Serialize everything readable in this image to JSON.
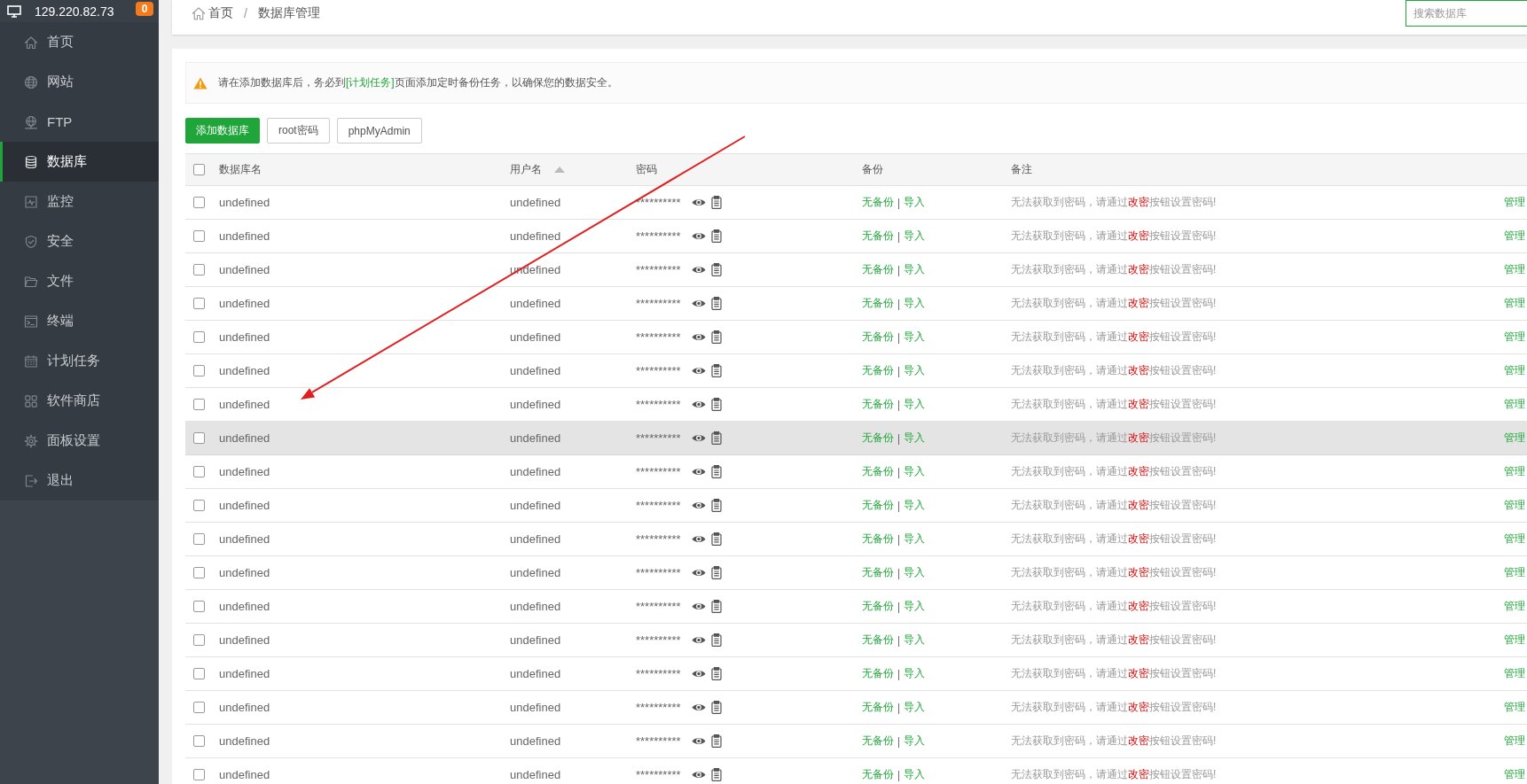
{
  "sidebar": {
    "ip": "129.220.82.73",
    "badge": "0",
    "items": [
      {
        "label": "首页",
        "selected": false
      },
      {
        "label": "网站",
        "selected": false
      },
      {
        "label": "FTP",
        "selected": false
      },
      {
        "label": "数据库",
        "selected": true
      },
      {
        "label": "监控",
        "selected": false
      },
      {
        "label": "安全",
        "selected": false
      },
      {
        "label": "文件",
        "selected": false
      },
      {
        "label": "终端",
        "selected": false
      },
      {
        "label": "计划任务",
        "selected": false
      },
      {
        "label": "软件商店",
        "selected": false
      },
      {
        "label": "面板设置",
        "selected": false
      },
      {
        "label": "退出",
        "selected": false
      }
    ]
  },
  "breadcrumb": {
    "items": [
      "首页",
      "数据库管理"
    ],
    "separator": "/"
  },
  "search": {
    "placeholder": "搜索数据库"
  },
  "notice": {
    "before": "请在添加数据库后，务必到",
    "link": "[计划任务]",
    "after": "页面添加定时备份任务，以确保您的数据安全。"
  },
  "buttons": [
    {
      "label": "添加数据库",
      "kind": "primary"
    },
    {
      "label": "root密码",
      "kind": "default"
    },
    {
      "label": "phpMyAdmin",
      "kind": "default"
    }
  ],
  "table": {
    "select_all": {
      "checked": false
    },
    "columns": [
      {
        "label": "数据库名",
        "sorted": false
      },
      {
        "label": "用户名",
        "sorted": true
      },
      {
        "label": "密码",
        "sorted": false
      },
      {
        "label": "备份",
        "sorted": false
      },
      {
        "label": "备注",
        "sorted": false
      }
    ],
    "rows": [
      {
        "checked": false,
        "hovered": false,
        "name": "undefined",
        "user": "undefined",
        "password": "**********",
        "backup": {
          "status": "无备份",
          "separator": "|",
          "action": "导入"
        },
        "remark": {
          "before": "无法获取到密码，请通过",
          "action": "改密",
          "after": "按钮设置密码!"
        },
        "operation": "管理"
      },
      {
        "checked": false,
        "hovered": false,
        "name": "undefined",
        "user": "undefined",
        "password": "**********",
        "backup": {
          "status": "无备份",
          "separator": "|",
          "action": "导入"
        },
        "remark": {
          "before": "无法获取到密码，请通过",
          "action": "改密",
          "after": "按钮设置密码!"
        },
        "operation": "管理"
      },
      {
        "checked": false,
        "hovered": false,
        "name": "undefined",
        "user": "undefined",
        "password": "**********",
        "backup": {
          "status": "无备份",
          "separator": "|",
          "action": "导入"
        },
        "remark": {
          "before": "无法获取到密码，请通过",
          "action": "改密",
          "after": "按钮设置密码!"
        },
        "operation": "管理"
      },
      {
        "checked": false,
        "hovered": false,
        "name": "undefined",
        "user": "undefined",
        "password": "**********",
        "backup": {
          "status": "无备份",
          "separator": "|",
          "action": "导入"
        },
        "remark": {
          "before": "无法获取到密码，请通过",
          "action": "改密",
          "after": "按钮设置密码!"
        },
        "operation": "管理"
      },
      {
        "checked": false,
        "hovered": false,
        "name": "undefined",
        "user": "undefined",
        "password": "**********",
        "backup": {
          "status": "无备份",
          "separator": "|",
          "action": "导入"
        },
        "remark": {
          "before": "无法获取到密码，请通过",
          "action": "改密",
          "after": "按钮设置密码!"
        },
        "operation": "管理"
      },
      {
        "checked": false,
        "hovered": false,
        "name": "undefined",
        "user": "undefined",
        "password": "**********",
        "backup": {
          "status": "无备份",
          "separator": "|",
          "action": "导入"
        },
        "remark": {
          "before": "无法获取到密码，请通过",
          "action": "改密",
          "after": "按钮设置密码!"
        },
        "operation": "管理"
      },
      {
        "checked": false,
        "hovered": false,
        "name": "undefined",
        "user": "undefined",
        "password": "**********",
        "backup": {
          "status": "无备份",
          "separator": "|",
          "action": "导入"
        },
        "remark": {
          "before": "无法获取到密码，请通过",
          "action": "改密",
          "after": "按钮设置密码!"
        },
        "operation": "管理"
      },
      {
        "checked": false,
        "hovered": true,
        "name": "undefined",
        "user": "undefined",
        "password": "**********",
        "backup": {
          "status": "无备份",
          "separator": "|",
          "action": "导入"
        },
        "remark": {
          "before": "无法获取到密码，请通过",
          "action": "改密",
          "after": "按钮设置密码!"
        },
        "operation": "管理"
      },
      {
        "checked": false,
        "hovered": false,
        "name": "undefined",
        "user": "undefined",
        "password": "**********",
        "backup": {
          "status": "无备份",
          "separator": "|",
          "action": "导入"
        },
        "remark": {
          "before": "无法获取到密码，请通过",
          "action": "改密",
          "after": "按钮设置密码!"
        },
        "operation": "管理"
      },
      {
        "checked": false,
        "hovered": false,
        "name": "undefined",
        "user": "undefined",
        "password": "**********",
        "backup": {
          "status": "无备份",
          "separator": "|",
          "action": "导入"
        },
        "remark": {
          "before": "无法获取到密码，请通过",
          "action": "改密",
          "after": "按钮设置密码!"
        },
        "operation": "管理"
      },
      {
        "checked": false,
        "hovered": false,
        "name": "undefined",
        "user": "undefined",
        "password": "**********",
        "backup": {
          "status": "无备份",
          "separator": "|",
          "action": "导入"
        },
        "remark": {
          "before": "无法获取到密码，请通过",
          "action": "改密",
          "after": "按钮设置密码!"
        },
        "operation": "管理"
      },
      {
        "checked": false,
        "hovered": false,
        "name": "undefined",
        "user": "undefined",
        "password": "**********",
        "backup": {
          "status": "无备份",
          "separator": "|",
          "action": "导入"
        },
        "remark": {
          "before": "无法获取到密码，请通过",
          "action": "改密",
          "after": "按钮设置密码!"
        },
        "operation": "管理"
      },
      {
        "checked": false,
        "hovered": false,
        "name": "undefined",
        "user": "undefined",
        "password": "**********",
        "backup": {
          "status": "无备份",
          "separator": "|",
          "action": "导入"
        },
        "remark": {
          "before": "无法获取到密码，请通过",
          "action": "改密",
          "after": "按钮设置密码!"
        },
        "operation": "管理"
      },
      {
        "checked": false,
        "hovered": false,
        "name": "undefined",
        "user": "undefined",
        "password": "**********",
        "backup": {
          "status": "无备份",
          "separator": "|",
          "action": "导入"
        },
        "remark": {
          "before": "无法获取到密码，请通过",
          "action": "改密",
          "after": "按钮设置密码!"
        },
        "operation": "管理"
      },
      {
        "checked": false,
        "hovered": false,
        "name": "undefined",
        "user": "undefined",
        "password": "**********",
        "backup": {
          "status": "无备份",
          "separator": "|",
          "action": "导入"
        },
        "remark": {
          "before": "无法获取到密码，请通过",
          "action": "改密",
          "after": "按钮设置密码!"
        },
        "operation": "管理"
      },
      {
        "checked": false,
        "hovered": false,
        "name": "undefined",
        "user": "undefined",
        "password": "**********",
        "backup": {
          "status": "无备份",
          "separator": "|",
          "action": "导入"
        },
        "remark": {
          "before": "无法获取到密码，请通过",
          "action": "改密",
          "after": "按钮设置密码!"
        },
        "operation": "管理"
      },
      {
        "checked": false,
        "hovered": false,
        "name": "undefined",
        "user": "undefined",
        "password": "**********",
        "backup": {
          "status": "无备份",
          "separator": "|",
          "action": "导入"
        },
        "remark": {
          "before": "无法获取到密码，请通过",
          "action": "改密",
          "after": "按钮设置密码!"
        },
        "operation": "管理"
      },
      {
        "checked": false,
        "hovered": false,
        "name": "undefined",
        "user": "undefined",
        "password": "**********",
        "backup": {
          "status": "无备份",
          "separator": "|",
          "action": "导入"
        },
        "remark": {
          "before": "无法获取到密码，请通过",
          "action": "改密",
          "after": "按钮设置密码!"
        },
        "operation": "管理"
      }
    ]
  }
}
